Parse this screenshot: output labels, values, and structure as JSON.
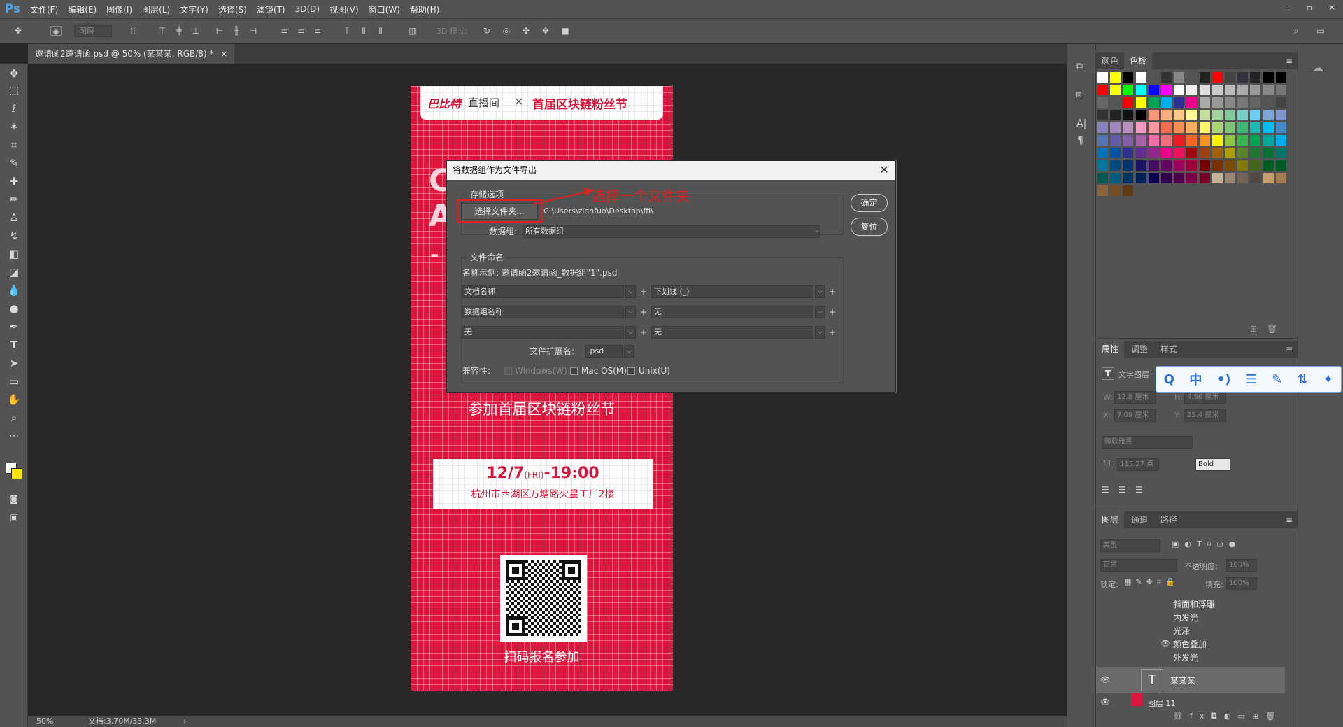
{
  "app": {
    "logo": "Ps"
  },
  "menu": [
    "文件(F)",
    "编辑(E)",
    "图像(I)",
    "图层(L)",
    "文字(Y)",
    "选择(S)",
    "滤镜(T)",
    "3D(D)",
    "视图(V)",
    "窗口(W)",
    "帮助(H)"
  ],
  "window_controls": [
    "–",
    "▫",
    "✕"
  ],
  "options_bar": {
    "layer_select": "图层",
    "mode_3d": "3D 模式:"
  },
  "document": {
    "tab_title": "邀请函2邀请函.psd @ 50% (某某某, RGB/8) *",
    "tab_close": "×"
  },
  "status": {
    "zoom": "50%",
    "doc_info": "文档:3.70M/33.3M",
    "arrow": "›"
  },
  "poster": {
    "brand": "巴比特",
    "brand_sub": "直播间",
    "cross": "×",
    "event_head": "首届区块链粉丝节",
    "invite_line": "参加首届区块链粉丝节",
    "date": "12/7",
    "weekday": "(FRI)",
    "time": "-19:00",
    "address": "杭州市西湖区万塘路火星工厂2楼",
    "scan_text": "扫码报名参加",
    "left_letters": [
      "C",
      "A",
      "-"
    ]
  },
  "dialog": {
    "title": "将数据组作为文件导出",
    "close": "✕",
    "annotation": "选择一个文件夹",
    "storage_group": "存储选项",
    "choose_folder": "选择文件夹...",
    "folder_path": "C:\\Users\\zionfuo\\Desktop\\ffi\\",
    "dataset_label": "数据组:",
    "dataset_value": "所有数据组",
    "ok": "确定",
    "reset": "复位",
    "naming_group": "文件命名",
    "example": "名称示例: 邀请函2邀请函_数据组\"1\".psd",
    "rows": [
      {
        "left": "文档名称",
        "right": "下划线 (_)"
      },
      {
        "left": "数据组名称",
        "right": "无"
      },
      {
        "left": "无",
        "right": "无"
      }
    ],
    "plus": "+",
    "ext_label": "文件扩展名:",
    "ext_value": ".psd",
    "compat_label": "兼容性:",
    "windows": "Windows(W)",
    "mac": "Mac OS(M)",
    "unix": "Unix(U)",
    "dd": "⌵"
  },
  "panels": {
    "swatch_tabs": [
      "颜色",
      "色板"
    ],
    "props_tabs": [
      "属性",
      "调整",
      "样式"
    ],
    "props_type": "文字图层",
    "w_label": "W:",
    "w_val": "12.8 厘米",
    "h_label": "H:",
    "h_val": "4.56 厘米",
    "x_label": "X:",
    "x_val": "7.09 厘米",
    "y_label": "Y:",
    "y_val": "25.4 厘米",
    "font_family": "微软雅黑",
    "font_size": "115.27 点",
    "font_style": "Bold",
    "layer_tabs": [
      "图层",
      "通道",
      "路径"
    ],
    "layer_filter": "类型",
    "blend_mode": "正常",
    "opacity_label": "不透明度:",
    "opacity_value": "100%",
    "lock_label": "锁定:",
    "fill_label": "填充:",
    "fill_value": "100%",
    "effects": [
      "斜面和浮雕",
      "内发光",
      "光泽",
      "颜色叠加",
      "外发光"
    ],
    "text_layer": "某某某",
    "image_layer": "图层 11",
    "menu_icon": "≡"
  },
  "ime": [
    "Q",
    "中",
    "•)",
    "☰",
    "✎",
    "⇅",
    "✦"
  ],
  "colors": {
    "accent_red": "#e0153d",
    "ui_bg": "#535353",
    "canvas_bg": "#282828"
  },
  "swatches": [
    [
      "#ffffff",
      "#ffff00",
      "#000000",
      "#ffffff",
      "#555555",
      "#333333",
      "#888888",
      "#555555",
      "#222222",
      "#ff0000",
      "#444444",
      "#333344",
      "#222222",
      "#000000",
      "#000000"
    ],
    [
      "#ff0000",
      "#ffff00",
      "#00ff00",
      "#00ffff",
      "#0000ff",
      "#ff00ff",
      "#ffffff",
      "#eeeeee",
      "#dddddd",
      "#cccccc",
      "#bbbbbb",
      "#aaaaaa",
      "#999999",
      "#888888",
      "#777777"
    ],
    [
      "#666666",
      "#555555",
      "#ff0000",
      "#ffff00",
      "#00a651",
      "#00aeef",
      "#2e3192",
      "#ec008c",
      "#aaaaaa",
      "#999999",
      "#888888",
      "#777777",
      "#666666",
      "#555555",
      "#444444"
    ],
    [
      "#333333",
      "#222222",
      "#111111",
      "#000000",
      "#f7977a",
      "#f9ad81",
      "#fdc68a",
      "#fff79a",
      "#c4df9b",
      "#a3d39c",
      "#82ca9d",
      "#7bcdc8",
      "#6ecff6",
      "#7ea7d8",
      "#8493ca"
    ],
    [
      "#8882be",
      "#a187be",
      "#bc8dbf",
      "#f49ac2",
      "#f6989d",
      "#f26c4f",
      "#f68e55",
      "#fbaf5c",
      "#fff467",
      "#acd372",
      "#7cc576",
      "#3bb878",
      "#1abbb4",
      "#00bff3",
      "#438ccb"
    ],
    [
      "#5574b9",
      "#605ca8",
      "#855fa8",
      "#a763a8",
      "#f06ea9",
      "#f26d7d",
      "#ed1c24",
      "#f26522",
      "#f7941d",
      "#fff200",
      "#8dc73f",
      "#39b54a",
      "#00a651",
      "#00a99d",
      "#00aeef"
    ],
    [
      "#0072bc",
      "#0054a6",
      "#2e3192",
      "#662d91",
      "#92278f",
      "#ec008c",
      "#ed145b",
      "#9e0b0f",
      "#a0410d",
      "#a36209",
      "#aba000",
      "#598527",
      "#1a7b30",
      "#007236",
      "#00746b"
    ],
    [
      "#0076a3",
      "#004b80",
      "#003471",
      "#1b1464",
      "#440e62",
      "#630460",
      "#9e005d",
      "#9e0039",
      "#790000",
      "#7b2e00",
      "#7d4900",
      "#827b00",
      "#406618",
      "#005e20",
      "#005826"
    ],
    [
      "#005952",
      "#005b7f",
      "#003663",
      "#002157",
      "#0d004c",
      "#32004b",
      "#4b0049",
      "#7b0046",
      "#7a0026",
      "#c7b299",
      "#998675",
      "#736357",
      "#534741",
      "#c69c6d",
      "#a67c52"
    ],
    [
      "#8c6239",
      "#754c24",
      "#603913"
    ]
  ]
}
